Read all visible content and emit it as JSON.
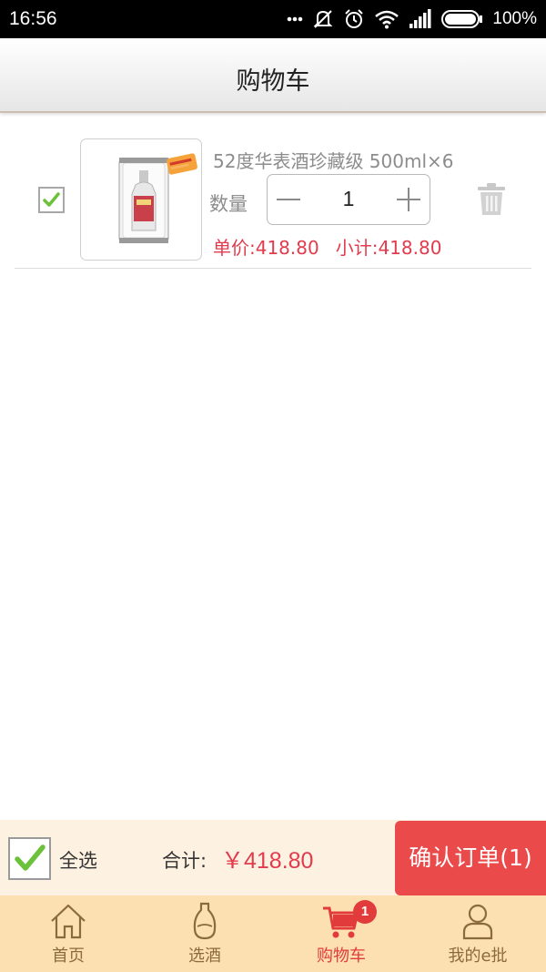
{
  "status_bar": {
    "time": "16:56",
    "battery": "100%",
    "icons": [
      "dots-icon",
      "mute-icon",
      "alarm-icon",
      "wifi-icon",
      "signal-icon",
      "battery-icon"
    ]
  },
  "header": {
    "title": "购物车"
  },
  "cart": {
    "items": [
      {
        "name": "52度华表酒珍藏级 500ml×6",
        "qty_label": "数量",
        "qty": "1",
        "unit_price": "单价:418.80",
        "subtotal": "小计:418.80",
        "checked": true
      }
    ]
  },
  "footer": {
    "select_all": "全选",
    "total_label": "合计:",
    "total_value": "￥418.80",
    "confirm": "确认订单(1)"
  },
  "tabbar": {
    "tabs": [
      {
        "label": "首页",
        "icon": "home-icon"
      },
      {
        "label": "选酒",
        "icon": "bottle-icon"
      },
      {
        "label": "购物车",
        "icon": "cart-icon",
        "active": true,
        "badge": "1"
      },
      {
        "label": "我的e批",
        "icon": "user-icon"
      }
    ]
  },
  "colors": {
    "accent_red": "#e23b4d",
    "confirm_bg": "#ea4a4a",
    "tabbar_bg": "#fde0b1",
    "totalbar_bg": "#fdf2e2",
    "check_green": "#6cc13b"
  }
}
